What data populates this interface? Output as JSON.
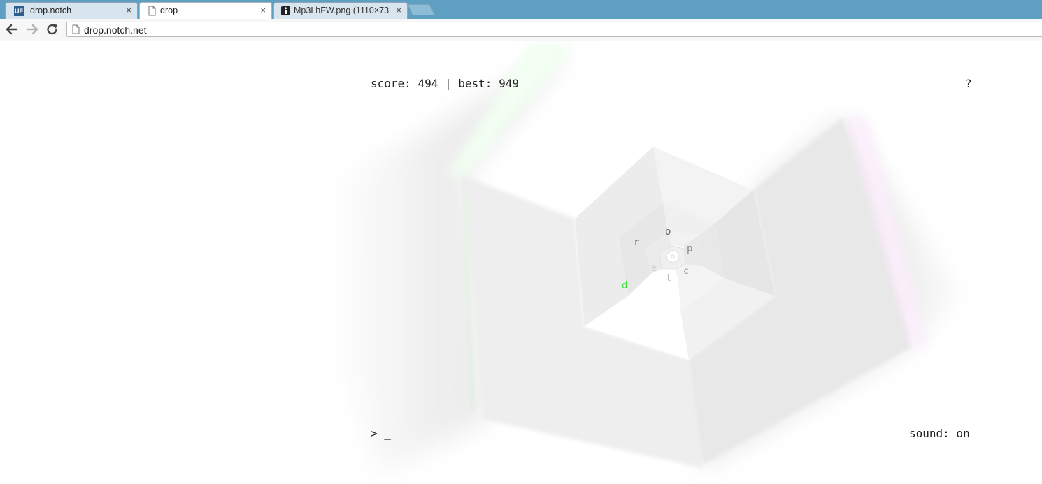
{
  "browser": {
    "tabs": [
      {
        "label": "drop.notch",
        "favicon": "uf-logo-icon",
        "active": false
      },
      {
        "label": "drop",
        "favicon": "page-icon",
        "active": true
      },
      {
        "label": "Mp3LhFW.png (1110×731)",
        "favicon": "image-tab-icon",
        "active": false
      }
    ],
    "close_glyph": "×",
    "address": "drop.notch.net"
  },
  "game": {
    "score_label": "score:",
    "score": "494",
    "separator": "|",
    "best_label": "best:",
    "best": "949",
    "help": "?",
    "prompt": ">",
    "cursor": "_",
    "sound": "sound: on",
    "tunnel_letters": [
      "d",
      "r",
      "o",
      "p",
      "c",
      "l",
      "e"
    ],
    "active_letter_color": "#39e339"
  },
  "colors": {
    "tabstrip": "#5f9fc2",
    "face_light": "#f5f5f5",
    "face_mid": "#ececec",
    "face_dark": "#e3e3e3"
  }
}
